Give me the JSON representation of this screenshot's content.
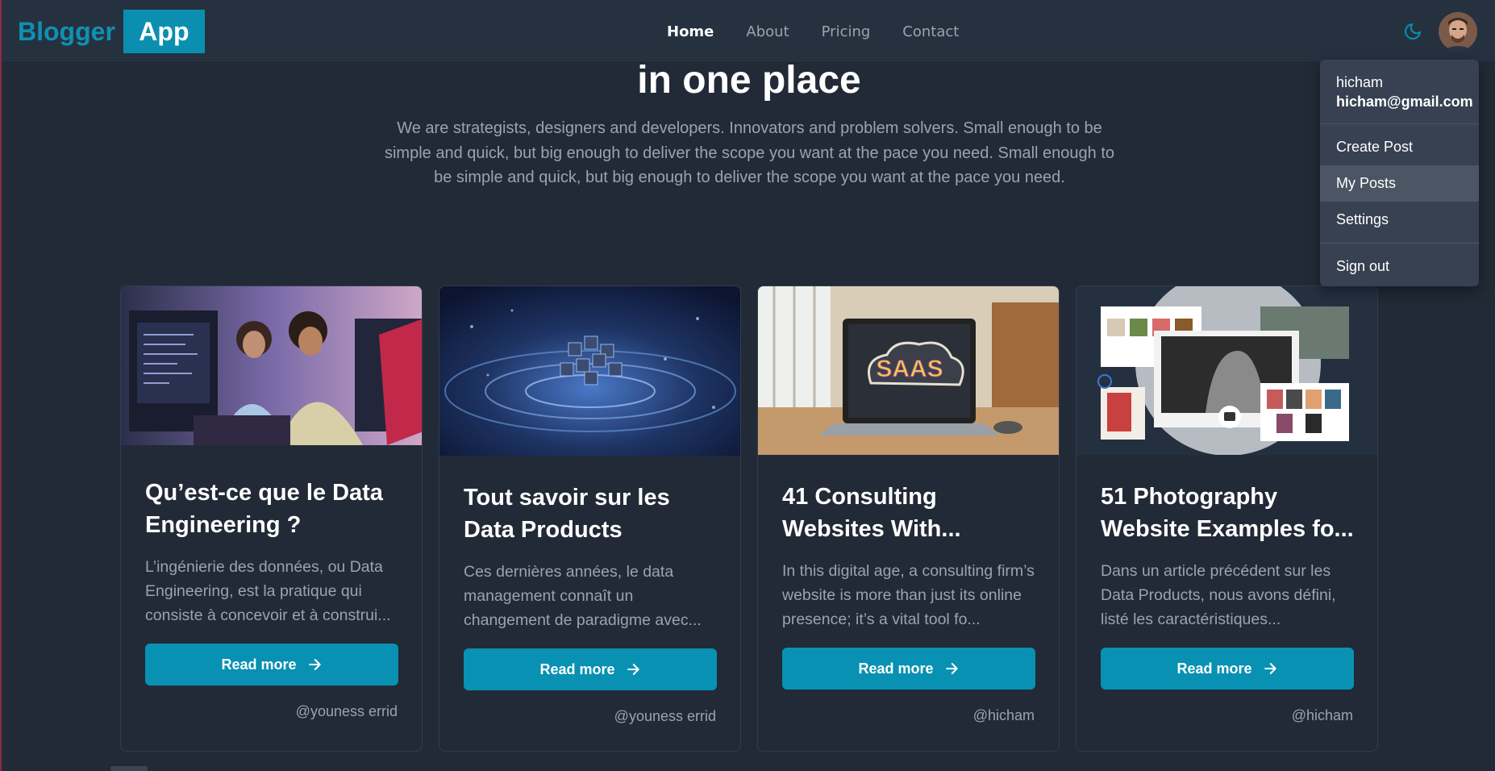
{
  "brand": {
    "left": "Blogger",
    "right": "App"
  },
  "nav": {
    "items": [
      {
        "label": "Home",
        "active": true
      },
      {
        "label": "About",
        "active": false
      },
      {
        "label": "Pricing",
        "active": false
      },
      {
        "label": "Contact",
        "active": false
      }
    ]
  },
  "hero": {
    "title": "in one place",
    "text": "We are strategists, designers and developers. Innovators and problem solvers. Small enough to be simple and quick, but big enough to deliver the scope you want at the pace you need. Small enough to be simple and quick, but big enough to deliver the scope you want at the pace you need."
  },
  "user_menu": {
    "name": "hicham",
    "email": "hicham@gmail.com",
    "items": [
      "Create Post",
      "My Posts",
      "Settings"
    ],
    "highlighted": "My Posts",
    "signout": "Sign out"
  },
  "cards": [
    {
      "title": "Qu’est-ce que le Data Engineering ?",
      "excerpt": "L’ingénierie des données, ou Data Engineering, est la pratique qui consiste à concevoir et à construi...",
      "button": "Read more",
      "author": "@youness errid"
    },
    {
      "title": "Tout savoir sur les Data Products",
      "excerpt": "Ces dernières années, le data management connaît un changement de paradigme avec...",
      "button": "Read more",
      "author": "@youness errid"
    },
    {
      "title": "41 Consulting Websites With...",
      "excerpt": "In this digital age, a consulting firm’s website is more than just its online presence; it’s a vital tool fo...",
      "button": "Read more",
      "author": "@hicham"
    },
    {
      "title": "51 Photography Website Examples fo...",
      "excerpt": "Dans un article précédent sur les Data Products, nous avons défini, listé les caractéristiques...",
      "button": "Read more",
      "author": "@hicham"
    }
  ],
  "images": {
    "card1": "photo of two developers at a computer",
    "card2": "abstract data visualization with glowing cubes",
    "card3": "laptop displaying SAAS graphic in an office",
    "card4": "collage of photography website screenshots"
  },
  "image_text": {
    "saas": "SAAS"
  },
  "colors": {
    "background": "#212a36",
    "navbar": "#263140",
    "accent": "#0891b2",
    "dropdown": "#374151"
  },
  "icons": {
    "theme": "moon-icon",
    "button": "arrow-right-icon"
  }
}
